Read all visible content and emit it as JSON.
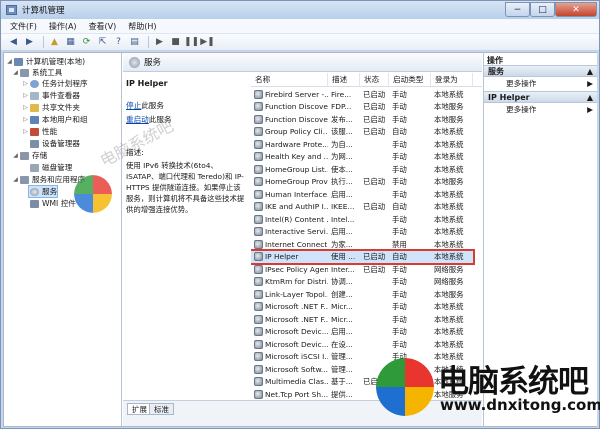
{
  "window": {
    "title": "计算机管理"
  },
  "menu": [
    "文件(F)",
    "操作(A)",
    "查看(V)",
    "帮助(H)"
  ],
  "toolbar": {
    "icons": [
      "back-icon",
      "forward-icon",
      "up-folder-icon",
      "show-hide-tree-icon",
      "refresh-icon",
      "export-icon",
      "help-icon",
      "properties-icon",
      "play-icon",
      "stop-icon",
      "pause-icon",
      "restart-icon"
    ]
  },
  "tree": [
    {
      "label": "计算机管理(本地)",
      "level": 0,
      "expanded": true,
      "icon": "computer-icon"
    },
    {
      "label": "系统工具",
      "level": 1,
      "expanded": true,
      "icon": "tools-icon"
    },
    {
      "label": "任务计划程序",
      "level": 2,
      "icon": "clock-icon"
    },
    {
      "label": "事件查看器",
      "level": 2,
      "icon": "event-viewer-icon"
    },
    {
      "label": "共享文件夹",
      "level": 2,
      "icon": "shared-folder-icon"
    },
    {
      "label": "本地用户和组",
      "level": 2,
      "icon": "users-icon"
    },
    {
      "label": "性能",
      "level": 2,
      "icon": "performance-icon"
    },
    {
      "label": "设备管理器",
      "level": 2,
      "icon": "device-manager-icon"
    },
    {
      "label": "存储",
      "level": 1,
      "expanded": true,
      "icon": "storage-icon"
    },
    {
      "label": "磁盘管理",
      "level": 2,
      "icon": "disk-icon"
    },
    {
      "label": "服务和应用程序",
      "level": 1,
      "expanded": true,
      "icon": "services-apps-icon"
    },
    {
      "label": "服务",
      "level": 2,
      "selected": true,
      "icon": "gear-icon"
    },
    {
      "label": "WMI 控件",
      "level": 2,
      "icon": "wmi-icon"
    }
  ],
  "panel": {
    "header": "服务",
    "service_name": "IP Helper",
    "stop_link": "停止",
    "stop_suffix": "此服务",
    "restart_link": "重启动",
    "restart_suffix": "此服务",
    "desc_label": "描述:",
    "desc_text": "使用 IPv6 转换技术(6to4、ISATAP、端口代理和 Teredo)和 IP-HTTPS 提供隧道连接。如果停止该服务，则计算机将不具备这些技术提供的增强连接优势。"
  },
  "grid": {
    "columns": [
      "名称",
      "描述",
      "状态",
      "启动类型",
      "登录为"
    ],
    "rows": [
      [
        "Firebird Server -...",
        "Fire...",
        "已启动",
        "手动",
        "本地系统"
      ],
      [
        "Function Discove...",
        "FDP...",
        "已启动",
        "手动",
        "本地服务"
      ],
      [
        "Function Discove...",
        "发布...",
        "已启动",
        "手动",
        "本地服务"
      ],
      [
        "Group Policy Cli...",
        "该服...",
        "已启动",
        "自动",
        "本地系统"
      ],
      [
        "Hardware Prote...",
        "为自...",
        "",
        "手动",
        "本地系统"
      ],
      [
        "Health Key and ...",
        "为网...",
        "",
        "手动",
        "本地系统"
      ],
      [
        "HomeGroup List...",
        "使本...",
        "",
        "手动",
        "本地系统"
      ],
      [
        "HomeGroup Prov...",
        "执行...",
        "已启动",
        "手动",
        "本地服务"
      ],
      [
        "Human Interface...",
        "启用...",
        "",
        "手动",
        "本地系统"
      ],
      [
        "IKE and AuthIP I...",
        "IKEE...",
        "已启动",
        "自动",
        "本地系统"
      ],
      [
        "Intel(R) Content ...",
        "Intel...",
        "",
        "手动",
        "本地系统"
      ],
      [
        "Interactive Servi...",
        "启用...",
        "",
        "手动",
        "本地系统"
      ],
      [
        "Internet Connect...",
        "为家...",
        "",
        "禁用",
        "本地系统"
      ],
      [
        "IP Helper",
        "使用 ...",
        "已启动",
        "自动",
        "本地系统"
      ],
      [
        "IPsec Policy Agent",
        "Inter...",
        "已启动",
        "手动",
        "网络服务"
      ],
      [
        "KtmRm for Distri...",
        "协调...",
        "",
        "手动",
        "网络服务"
      ],
      [
        "Link-Layer Topol...",
        "创建...",
        "",
        "手动",
        "本地服务"
      ],
      [
        "Microsoft .NET F...",
        "Micr...",
        "",
        "手动",
        "本地系统"
      ],
      [
        "Microsoft .NET F...",
        "Micr...",
        "",
        "手动",
        "本地系统"
      ],
      [
        "Microsoft Devic...",
        "启用...",
        "",
        "手动",
        "本地系统"
      ],
      [
        "Microsoft Devic...",
        "在设...",
        "",
        "手动",
        "本地系统"
      ],
      [
        "Microsoft iSCSI I...",
        "管理...",
        "",
        "手动",
        "本地系统"
      ],
      [
        "Microsoft Softw...",
        "管理...",
        "",
        "手动",
        "本地系统"
      ],
      [
        "Multimedia Clas...",
        "基于...",
        "已启动",
        "自动",
        "本地系统"
      ],
      [
        "Net.Tcp Port Sh...",
        "提供...",
        "",
        "禁用",
        "本地服务"
      ]
    ],
    "highlight_index": 13,
    "highlight_color": "#d93a32"
  },
  "tabs": [
    "扩展",
    "标准"
  ],
  "actions": {
    "title": "操作",
    "sections": [
      {
        "title": "服务",
        "items": [
          "更多操作"
        ]
      },
      {
        "title": "IP Helper",
        "items": [
          "更多操作"
        ]
      }
    ]
  },
  "watermark": {
    "text": "电脑系统吧"
  },
  "brand": {
    "name": "电脑系统吧",
    "url": "www.dnxitong.com",
    "colors": [
      "#e8352e",
      "#2f9a3a",
      "#1f6fd1",
      "#f5b400"
    ]
  }
}
